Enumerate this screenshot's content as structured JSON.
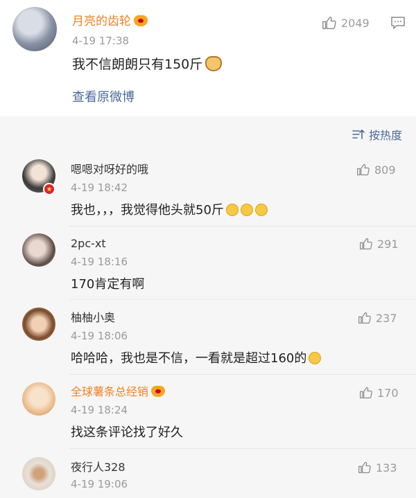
{
  "post": {
    "username": "月亮的齿轮",
    "time": "4-19 17:38",
    "content": "我不信朗朗只有150斤",
    "likes": "2049",
    "view_original": "查看原微博"
  },
  "sort_label": "按热度",
  "comments": [
    {
      "username": "嗯嗯对呀好的哦",
      "time": "4-19 18:42",
      "content": "我也，，，我觉得他头就50斤",
      "likes": "809"
    },
    {
      "username": "2pc-xt",
      "time": "4-19 18:16",
      "content": "170肯定有啊",
      "likes": "291"
    },
    {
      "username": "柚柚小奥",
      "time": "4-19 18:06",
      "content": "哈哈哈，我也是不信，一看就是超过160的",
      "likes": "237"
    },
    {
      "username": "全球薯条总经销",
      "time": "4-19 18:24",
      "content": "找这条评论找了好久",
      "likes": "170"
    },
    {
      "username": "夜行人328",
      "time": "4-19 19:06",
      "content": "",
      "likes": "133"
    }
  ],
  "colors": {
    "accent_orange": "#f08224",
    "link_blue": "#4a6a9b",
    "meta_gray": "#9a9a9a"
  },
  "icons": [
    "thumbs-up-icon",
    "comment-icon",
    "sort-icon",
    "vip-badge-icon",
    "cat-emoji-icon",
    "face-emoji-icon"
  ]
}
